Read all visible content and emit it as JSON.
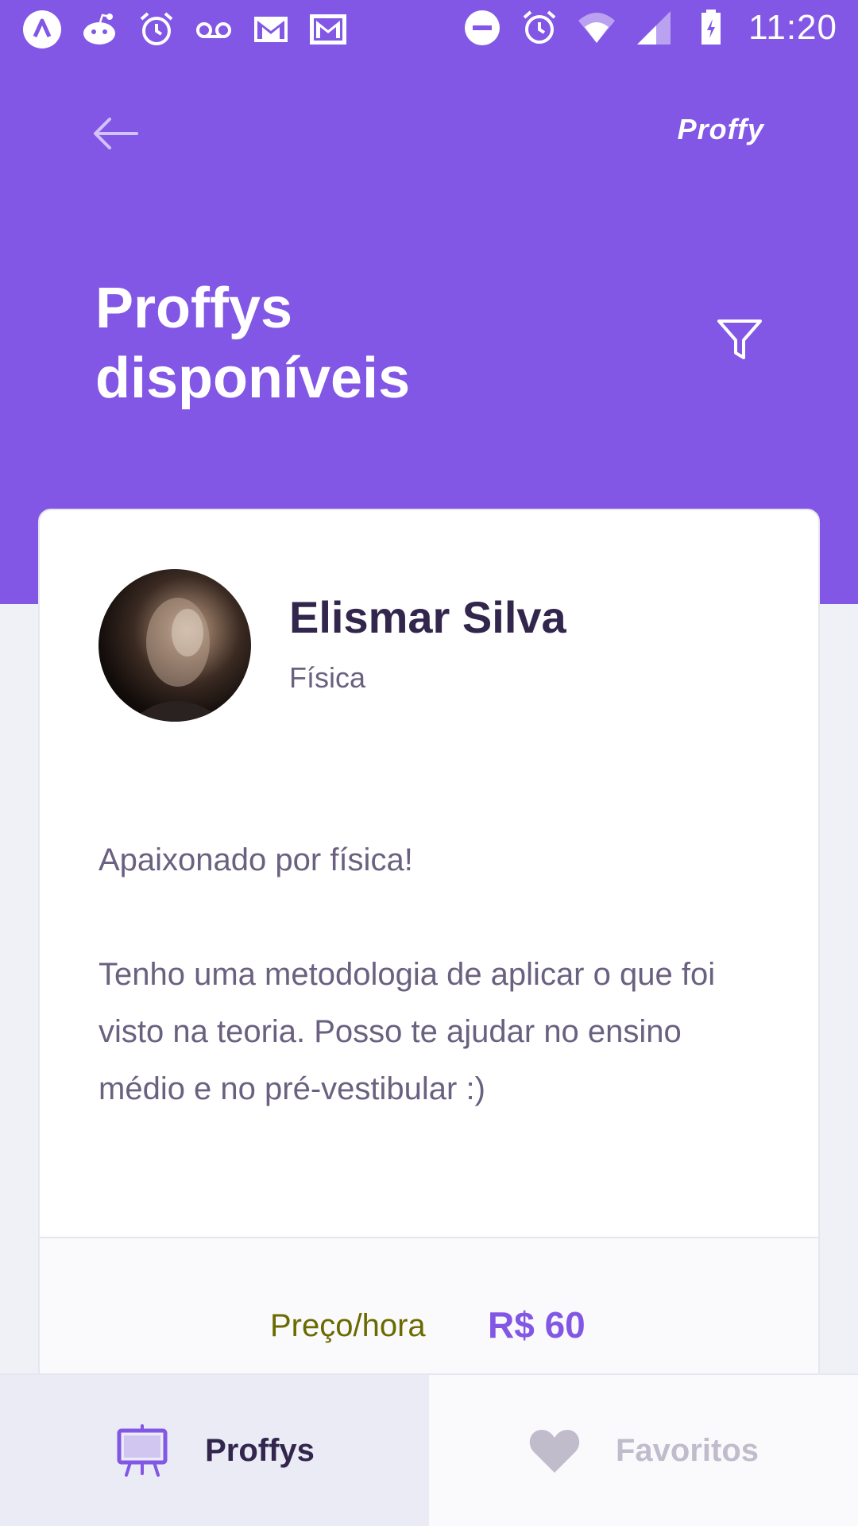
{
  "status_bar": {
    "time": "11:20",
    "left_icons": [
      "app-icon",
      "reddit-icon",
      "alarm-icon",
      "voicemail-icon",
      "gmail-icon",
      "gmail-icon"
    ],
    "right_icons": [
      "do-not-disturb-icon",
      "alarm-icon",
      "wifi-icon",
      "signal-icon",
      "battery-icon"
    ]
  },
  "header": {
    "brand": "Proffy",
    "title": "Proffys disponíveis",
    "icons": {
      "back": "arrow-left-icon",
      "filter": "filter-icon"
    }
  },
  "teacher_card": {
    "name": "Elismar Silva",
    "subject": "Física",
    "bio": [
      "Apaixonado por física!",
      "Tenho uma metodologia de aplicar o que foi visto na teoria. Posso te ajudar no ensino médio e no pré-vestibular :)"
    ],
    "price_label": "Preço/hora",
    "price_value": "R$ 60"
  },
  "tabs": [
    {
      "label": "Proffys",
      "icon": "easel-icon",
      "active": true
    },
    {
      "label": "Favoritos",
      "icon": "heart-icon",
      "active": false
    }
  ],
  "colors": {
    "primary": "#8257E5",
    "title_text": "#32264D",
    "body_text": "#6A6180",
    "background": "#F0F0F7",
    "price_label": "#6A6A00",
    "inactive_tab": "#C1BCCC"
  }
}
